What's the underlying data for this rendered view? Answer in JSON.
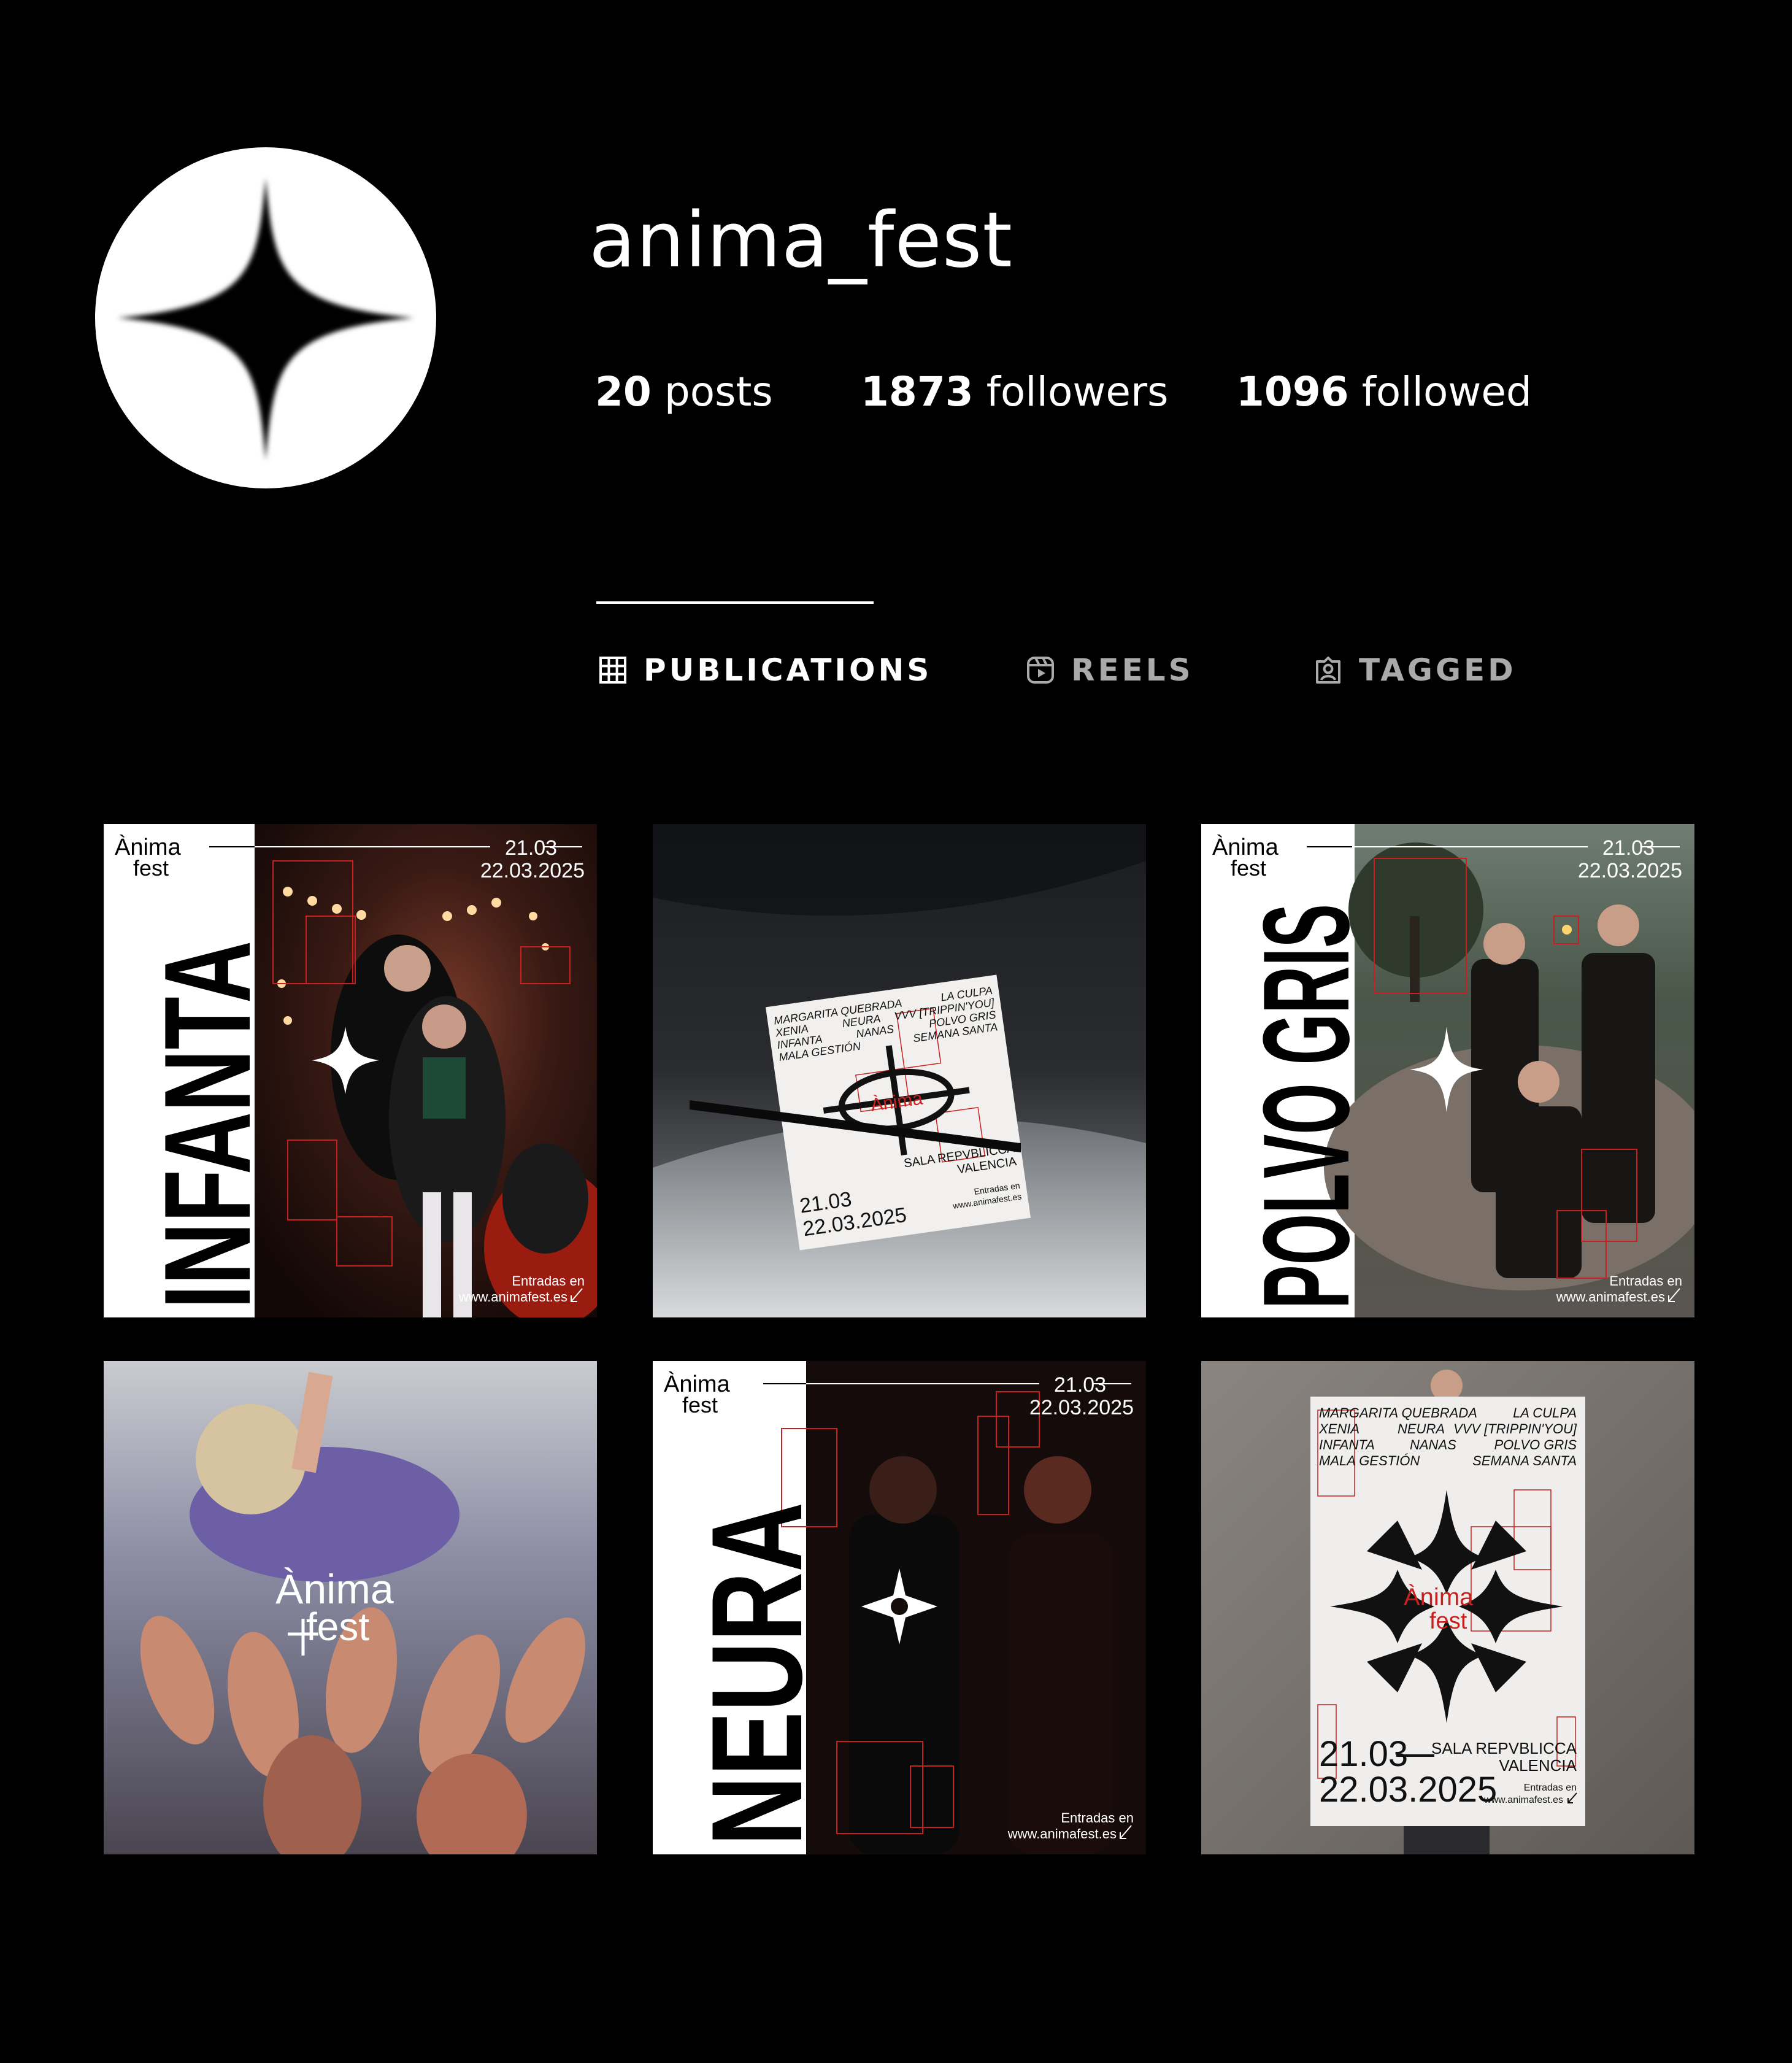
{
  "profile": {
    "username": "anima_fest",
    "stats": [
      {
        "num": "20",
        "label": "posts"
      },
      {
        "num": "1873",
        "label": "followers"
      },
      {
        "num": "1096",
        "label": "followed"
      }
    ]
  },
  "tabs": [
    {
      "label": "PUBLICATIONS",
      "icon": "grid-icon",
      "active": true
    },
    {
      "label": "REELS",
      "icon": "reels-icon",
      "active": false
    },
    {
      "label": "TAGGED",
      "icon": "tagged-icon",
      "active": false
    }
  ],
  "posts": [
    {
      "band": "INFANTA",
      "logo_line1": "Ànima",
      "logo_line2": "fest",
      "date1": "21.03",
      "date2": "22.03.2025",
      "cta1": "Entradas en",
      "cta2": "www.animafest.es"
    },
    {
      "flyer_left": [
        "MARGARITA QUEBRADA",
        "XENIA",
        "INFANTA",
        "MALA GESTIÓN"
      ],
      "flyer_mid": [
        "NEURA",
        "NANAS"
      ],
      "flyer_right": [
        "LA CULPA",
        "VVV [TRIPPIN'YOU]",
        "POLVO GRIS",
        "SEMANA SANTA"
      ],
      "logo_line1": "Ànima",
      "logo_line2": "fest",
      "venue1": "SALA REPVBLICCA",
      "venue2": "VALENCIA",
      "date1": "21.03",
      "date2": "22.03.2025",
      "cta1": "Entradas en",
      "cta2": "www.animafest.es"
    },
    {
      "band": "POLVO GRIS",
      "logo_line1": "Ànima",
      "logo_line2": "fest",
      "date1": "21.03",
      "date2": "22.03.2025",
      "cta1": "Entradas en",
      "cta2": "www.animafest.es"
    },
    {
      "logo_line1": "Ànima",
      "logo_line2": "fest"
    },
    {
      "band": "NEURA",
      "logo_line1": "Ànima",
      "logo_line2": "fest",
      "date1": "21.03",
      "date2": "22.03.2025",
      "cta1": "Entradas en",
      "cta2": "www.animafest.es"
    },
    {
      "flyer_left": [
        "MARGARITA QUEBRADA",
        "XENIA",
        "INFANTA",
        "MALA GESTIÓN"
      ],
      "flyer_mid": [
        "NEURA",
        "NANAS"
      ],
      "flyer_right": [
        "LA CULPA",
        "VVV [TRIPPIN'YOU]",
        "POLVO GRIS",
        "SEMANA SANTA"
      ],
      "logo_line1": "Ànima",
      "logo_line2": "fest",
      "venue1": "SALA REPVBLICCA",
      "venue2": "VALENCIA",
      "date1": "21.03",
      "date2": "22.03.2025",
      "cta1": "Entradas en",
      "cta2": "www.animafest.es"
    }
  ],
  "colors": {
    "background": "#000000",
    "accent_red": "#c8201e",
    "text_inactive": "#aaaaaa"
  }
}
